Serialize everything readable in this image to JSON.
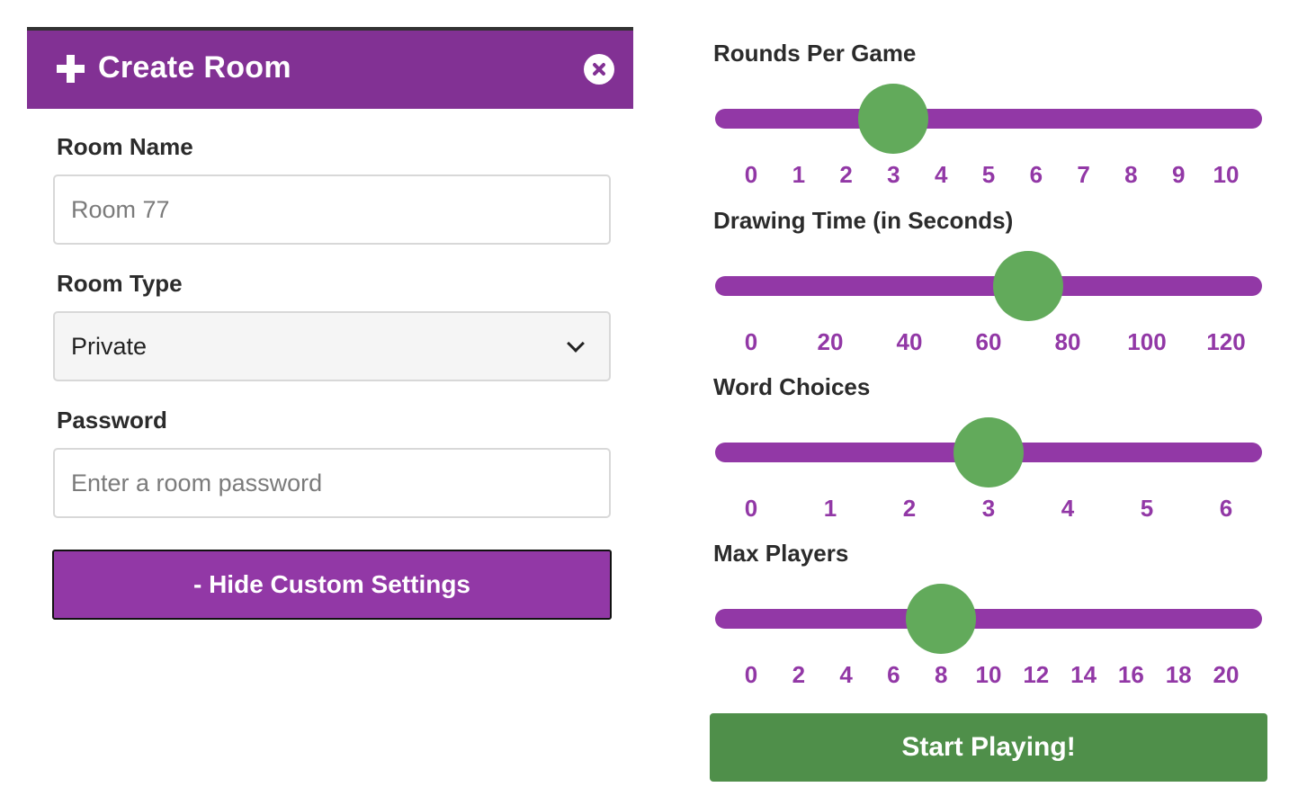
{
  "panel": {
    "title": "Create Room",
    "room_name": {
      "label": "Room Name",
      "value": "",
      "placeholder": "Room 77"
    },
    "room_type": {
      "label": "Room Type",
      "selected": "Private"
    },
    "password": {
      "label": "Password",
      "value": "",
      "placeholder": "Enter a room password"
    },
    "toggle_button_label": "- Hide Custom Settings"
  },
  "sliders": [
    {
      "label": "Rounds Per Game",
      "ticks": [
        "0",
        "1",
        "2",
        "3",
        "4",
        "5",
        "6",
        "7",
        "8",
        "9",
        "10"
      ],
      "min": 0,
      "max": 10,
      "value": 3
    },
    {
      "label": "Drawing Time (in Seconds)",
      "ticks": [
        "0",
        "20",
        "40",
        "60",
        "80",
        "100",
        "120"
      ],
      "min": 0,
      "max": 120,
      "value": 70
    },
    {
      "label": "Word Choices",
      "ticks": [
        "0",
        "1",
        "2",
        "3",
        "4",
        "5",
        "6"
      ],
      "min": 0,
      "max": 6,
      "value": 3
    },
    {
      "label": "Max Players",
      "ticks": [
        "0",
        "2",
        "4",
        "6",
        "8",
        "10",
        "12",
        "14",
        "16",
        "18",
        "20"
      ],
      "min": 0,
      "max": 20,
      "value": 8
    }
  ],
  "start_button_label": "Start Playing!",
  "colors": {
    "header": "#823194",
    "accent": "#9238a6",
    "thumb": "#62aa5b",
    "start": "#4f8f4a"
  }
}
